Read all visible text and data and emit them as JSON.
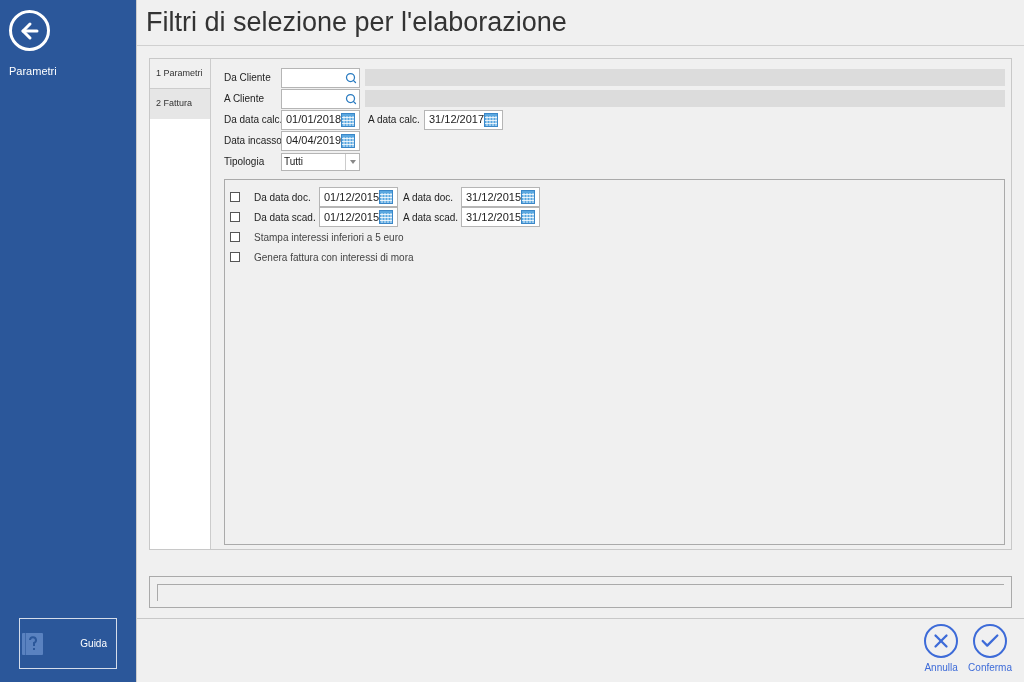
{
  "sidebar": {
    "back_label": "Parametri",
    "help_label": "Guida"
  },
  "title": "Filtri di selezione per l'elaborazione",
  "tabs": [
    {
      "label": "1 Parametri",
      "selected": true
    },
    {
      "label": "2 Fattura",
      "selected": false
    }
  ],
  "fields": [
    {
      "kind": "lookup",
      "label": "Da Cliente"
    },
    {
      "kind": "lookup",
      "label": "A Cliente"
    },
    {
      "kind": "date_pair",
      "label": "Da data calc.",
      "value": "01/01/2018",
      "label2": "A data calc.",
      "value2": "31/12/2017"
    },
    {
      "kind": "date",
      "label": "Data incasso",
      "value": "04/04/2019"
    },
    {
      "kind": "select",
      "label": "Tipologia",
      "value": "Tutti"
    }
  ],
  "options": [
    {
      "kind": "date_pair",
      "checked": false,
      "label": "Da data doc.",
      "value": "01/12/2015",
      "label2": "A data doc.",
      "value2": "31/12/2015"
    },
    {
      "kind": "date_pair",
      "checked": false,
      "label": "Da data scad.",
      "value": "01/12/2015",
      "label2": "A data scad.",
      "value2": "31/12/2015"
    },
    {
      "kind": "check",
      "checked": false,
      "label": "Stampa interessi inferiori a 5 euro"
    },
    {
      "kind": "check",
      "checked": false,
      "label": "Genera fattura con interessi di mora"
    }
  ],
  "actions": [
    {
      "kind": "cancel",
      "label": "Annulla"
    },
    {
      "kind": "confirm",
      "label": "Conferma"
    }
  ]
}
